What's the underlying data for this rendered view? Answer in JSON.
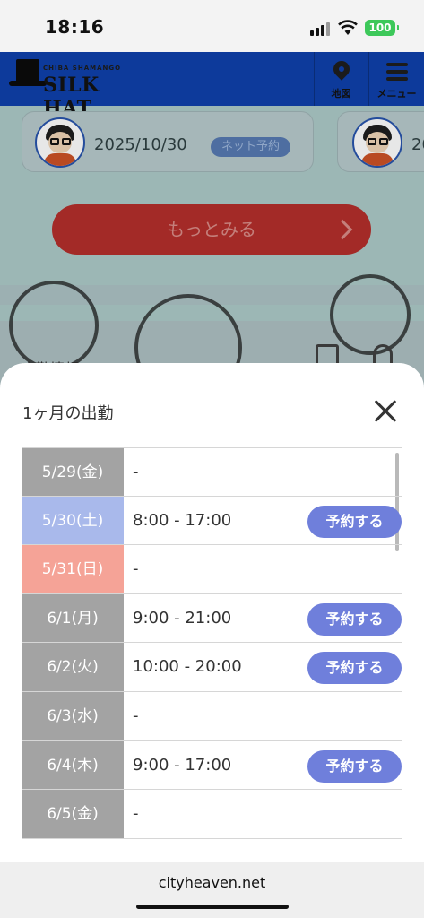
{
  "status_bar": {
    "time": "18:16",
    "battery": "100",
    "icons": [
      "signal-icon",
      "wifi-icon",
      "battery-icon"
    ]
  },
  "site": {
    "logo_sub": "CHIBA SHAMANGO",
    "logo_text": "SILK HAT",
    "map_label": "地図",
    "menu_label": "メニュー",
    "review_date": "2025/10/30",
    "review_date_partial": "20",
    "net_badge": "ネット予約",
    "more_button": "もっとみる",
    "section_title": "出勤情報"
  },
  "modal": {
    "title": "1ヶ月の出勤",
    "close_icon": "close-icon",
    "reserve_label": "予約する",
    "rows": [
      {
        "day": "5/29(金)",
        "hours": "-",
        "type": "weekday",
        "reservable": false
      },
      {
        "day": "5/30(土)",
        "hours": "8:00 - 17:00",
        "type": "sat",
        "reservable": true
      },
      {
        "day": "5/31(日)",
        "hours": "-",
        "type": "sun",
        "reservable": false
      },
      {
        "day": "6/1(月)",
        "hours": "9:00 - 21:00",
        "type": "weekday",
        "reservable": true
      },
      {
        "day": "6/2(火)",
        "hours": "10:00 - 20:00",
        "type": "weekday",
        "reservable": true
      },
      {
        "day": "6/3(水)",
        "hours": "-",
        "type": "weekday",
        "reservable": false
      },
      {
        "day": "6/4(木)",
        "hours": "9:00 - 17:00",
        "type": "weekday",
        "reservable": true
      },
      {
        "day": "6/5(金)",
        "hours": "-",
        "type": "weekday",
        "reservable": false
      }
    ]
  },
  "browser": {
    "url": "cityheaven.net"
  },
  "colors": {
    "header_blue": "#0d3a9b",
    "saturday": "#a9b9eb",
    "sunday": "#f5a397",
    "weekday": "#a3a3a3",
    "reserve_button": "#6f7fdb"
  }
}
